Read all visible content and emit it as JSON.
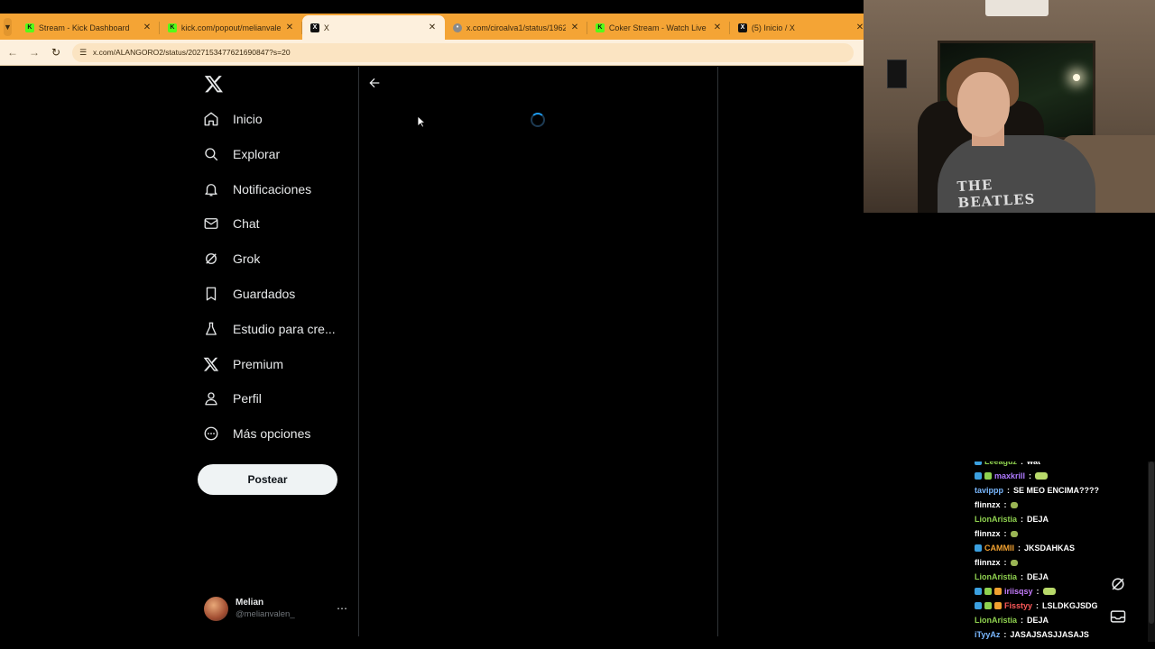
{
  "browser": {
    "tabs": [
      {
        "title": "Stream - Kick Dashboard",
        "favicon": "kick-icon",
        "active": false
      },
      {
        "title": "kick.com/popout/melianvalen/ch",
        "favicon": "kick-icon",
        "active": false
      },
      {
        "title": "X",
        "favicon": "x-icon",
        "active": true
      },
      {
        "title": "x.com/ciroalva1/status/1962346",
        "favicon": "globe-icon",
        "active": false
      },
      {
        "title": "Coker Stream - Watch Live on Kick",
        "favicon": "kick-icon",
        "active": false
      },
      {
        "title": "(5) Inicio / X",
        "favicon": "x-icon",
        "active": false
      }
    ],
    "url": "x.com/ALANGORO2/status/2027153477621690847?s=20",
    "accent_color": "#f4a435"
  },
  "nav": {
    "items": [
      {
        "label": "Inicio",
        "icon": "home-icon"
      },
      {
        "label": "Explorar",
        "icon": "search-icon"
      },
      {
        "label": "Notificaciones",
        "icon": "bell-icon"
      },
      {
        "label": "Chat",
        "icon": "mail-icon"
      },
      {
        "label": "Grok",
        "icon": "grok-icon"
      },
      {
        "label": "Guardados",
        "icon": "bookmark-icon"
      },
      {
        "label": "Estudio para cre...",
        "icon": "flask-icon"
      },
      {
        "label": "Premium",
        "icon": "x-logo-icon"
      },
      {
        "label": "Perfil",
        "icon": "person-icon"
      },
      {
        "label": "Más opciones",
        "icon": "more-circle-icon"
      }
    ],
    "post_button": "Postear"
  },
  "account": {
    "name": "Melian",
    "handle": "@melianvalen_"
  },
  "webcam": {
    "shirt_text": "THE BEATLES"
  },
  "chat": {
    "messages": [
      {
        "user": "Leeaguz",
        "color": "#8fd14f",
        "text": "wat",
        "badges": 1
      },
      {
        "user": "maxkrill",
        "color": "#b07bff",
        "text": "",
        "emote": true,
        "badges": 2
      },
      {
        "user": "tavippp",
        "color": "#7ab8ff",
        "text": "SE MEO ENCIMA????",
        "badges": 0
      },
      {
        "user": "flinnzx",
        "color": "#ffffff",
        "text": "",
        "emote": true,
        "badges": 0
      },
      {
        "user": "LionAristia",
        "color": "#8fd14f",
        "text": "DEJA",
        "badges": 0
      },
      {
        "user": "flinnzx",
        "color": "#ffffff",
        "text": "",
        "emote": true,
        "badges": 0
      },
      {
        "user": "CAMMII",
        "color": "#f0a030",
        "text": "JKSDAHKAS",
        "badges": 1
      },
      {
        "user": "flinnzx",
        "color": "#ffffff",
        "text": "",
        "emote": true,
        "badges": 0
      },
      {
        "user": "LionAristia",
        "color": "#8fd14f",
        "text": "DEJA",
        "badges": 0
      },
      {
        "user": "iriisqsy",
        "color": "#c77dff",
        "text": "",
        "emote": true,
        "badges": 3
      },
      {
        "user": "Fisstyy",
        "color": "#ff5a5a",
        "text": "LSLDKGJSDG",
        "badges": 3
      },
      {
        "user": "LionAristia",
        "color": "#8fd14f",
        "text": "DEJA",
        "badges": 0
      },
      {
        "user": "iTyyAz",
        "color": "#7ab8ff",
        "text": "JASAJSASJJASAJS",
        "badges": 0
      }
    ]
  }
}
